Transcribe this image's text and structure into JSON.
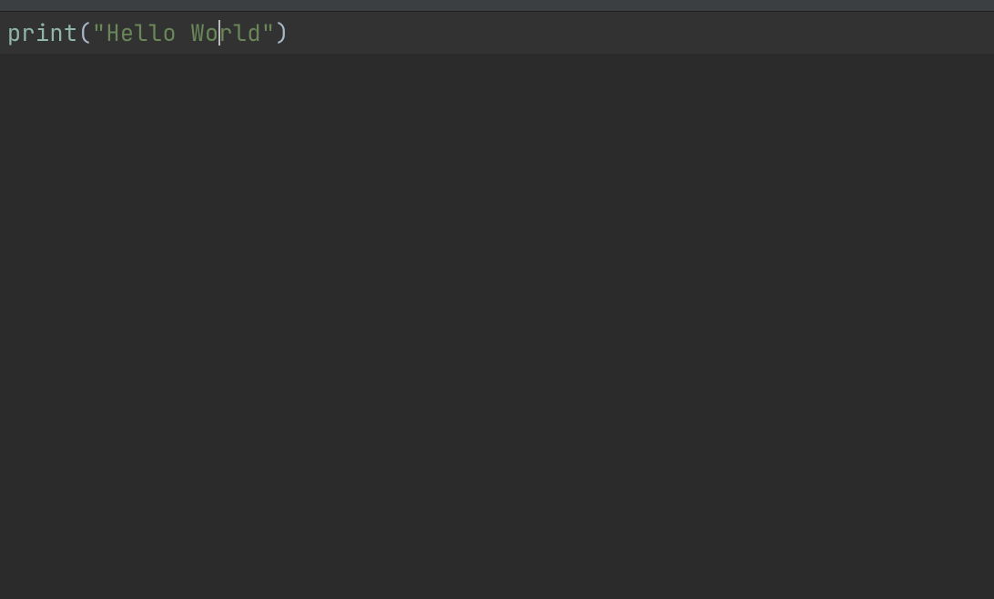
{
  "editor": {
    "line1": {
      "func": "print",
      "open_paren": "(",
      "string": "\"Hello World\"",
      "close_paren": ")"
    },
    "cursor_column": 15,
    "highlighted_line": 1
  },
  "colors": {
    "background": "#2b2b2b",
    "current_line": "#323232",
    "title_bar": "#3c3f41",
    "function": "#8fb6a8",
    "string": "#6a8759",
    "punctuation": "#a9b7c6",
    "cursor": "#bbbbbb"
  }
}
